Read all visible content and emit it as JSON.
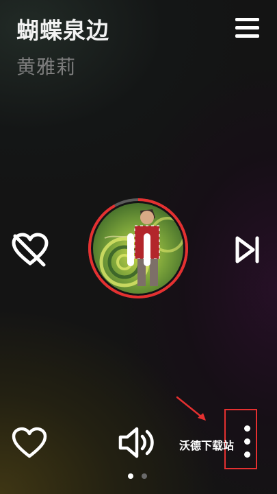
{
  "song": {
    "title": "蝴蝶泉边",
    "artist": "黄雅莉"
  },
  "player": {
    "state": "playing",
    "progress_fraction": 0.92
  },
  "watermark": {
    "text": "沃德下载站"
  },
  "pager": {
    "pages": 2,
    "active_page": 1
  },
  "colors": {
    "accent": "#e53030",
    "title_text": "#f2f2f2",
    "artist_text": "#7d7d7d",
    "icon": "#ffffff"
  },
  "icons": {
    "menu": "hamburger-icon",
    "dislike": "heart-slash-icon",
    "next": "skip-next-icon",
    "pause": "pause-icon",
    "like": "heart-icon",
    "volume": "volume-icon",
    "more": "more-vertical-icon"
  }
}
